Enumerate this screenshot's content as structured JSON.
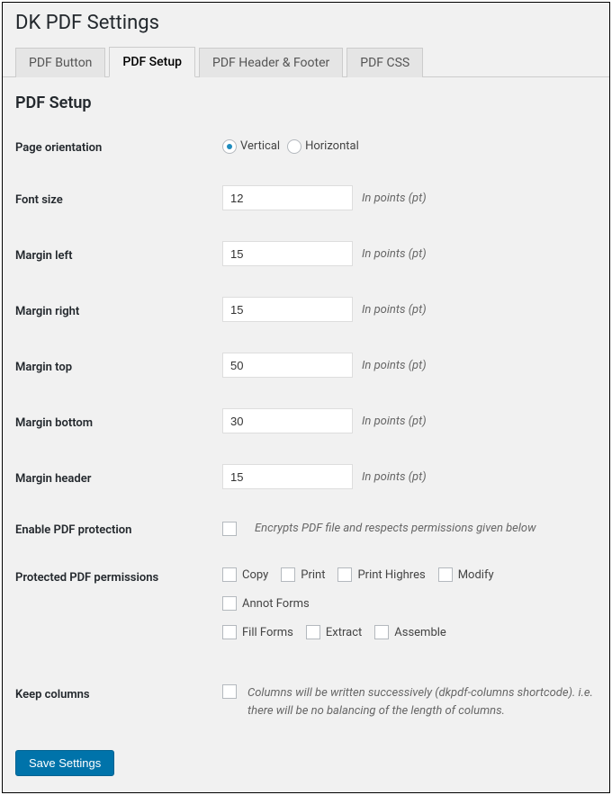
{
  "page_title": "DK PDF Settings",
  "tabs": [
    {
      "label": "PDF Button"
    },
    {
      "label": "PDF Setup"
    },
    {
      "label": "PDF Header & Footer"
    },
    {
      "label": "PDF CSS"
    }
  ],
  "section_title": "PDF Setup",
  "fields": {
    "orientation": {
      "label": "Page orientation",
      "options": {
        "vertical": "Vertical",
        "horizontal": "Horizontal"
      }
    },
    "font_size": {
      "label": "Font size",
      "value": "12",
      "hint": "In points (pt)"
    },
    "margin_left": {
      "label": "Margin left",
      "value": "15",
      "hint": "In points (pt)"
    },
    "margin_right": {
      "label": "Margin right",
      "value": "15",
      "hint": "In points (pt)"
    },
    "margin_top": {
      "label": "Margin top",
      "value": "50",
      "hint": "In points (pt)"
    },
    "margin_bottom": {
      "label": "Margin bottom",
      "value": "30",
      "hint": "In points (pt)"
    },
    "margin_header": {
      "label": "Margin header",
      "value": "15",
      "hint": "In points (pt)"
    },
    "protection": {
      "label": "Enable PDF protection",
      "hint": "Encrypts PDF file and respects permissions given below"
    },
    "permissions": {
      "label": "Protected PDF permissions",
      "options": {
        "copy": "Copy",
        "print": "Print",
        "print_highres": "Print Highres",
        "modify": "Modify",
        "annot_forms": "Annot Forms",
        "fill_forms": "Fill Forms",
        "extract": "Extract",
        "assemble": "Assemble"
      }
    },
    "keep_columns": {
      "label": "Keep columns",
      "hint": "Columns will be written successively (dkpdf-columns shortcode). i.e. there will be no balancing of the length of columns."
    }
  },
  "save_label": "Save Settings"
}
